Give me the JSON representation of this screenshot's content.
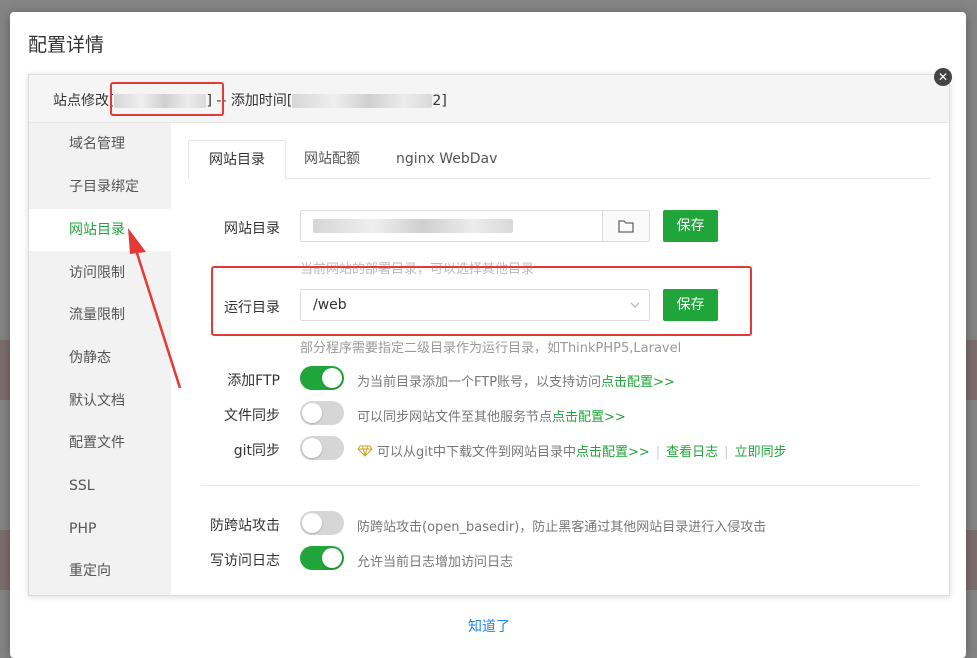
{
  "outer": {
    "title": "配置详情",
    "footer_link": "知道了"
  },
  "inner": {
    "title_prefix": "站点修改[",
    "title_mid": "] -- 添加时间[",
    "title_suffix": "2]"
  },
  "sidebar": {
    "items": [
      {
        "label": "域名管理"
      },
      {
        "label": "子目录绑定"
      },
      {
        "label": "网站目录"
      },
      {
        "label": "访问限制"
      },
      {
        "label": "流量限制"
      },
      {
        "label": "伪静态"
      },
      {
        "label": "默认文档"
      },
      {
        "label": "配置文件"
      },
      {
        "label": "SSL"
      },
      {
        "label": "PHP"
      },
      {
        "label": "重定向"
      }
    ],
    "active_index": 2
  },
  "tabs": [
    {
      "label": "网站目录"
    },
    {
      "label": "网站配额"
    },
    {
      "label": "nginx WebDav"
    }
  ],
  "form": {
    "site_dir": {
      "label": "网站目录",
      "save_label": "保存",
      "hint": "当前网站的部署目录，可以选择其他目录"
    },
    "run_dir": {
      "label": "运行目录",
      "value": "/web",
      "save_label": "保存",
      "hint": "部分程序需要指定二级目录作为运行目录，如ThinkPHP5,Laravel"
    },
    "ftp": {
      "label": "添加FTP",
      "on": true,
      "desc": "为当前目录添加一个FTP账号，以支持访问",
      "link": "点击配置>>"
    },
    "file_sync": {
      "label": "文件同步",
      "on": false,
      "desc": "可以同步网站文件至其他服务节点",
      "link": "点击配置>>"
    },
    "git_sync": {
      "label": "git同步",
      "on": false,
      "desc": "可以从git中下载文件到网站目录中",
      "link": "点击配置>>",
      "link_log": "查看日志",
      "link_sync": "立即同步"
    },
    "anti_cross": {
      "label": "防跨站攻击",
      "on": false,
      "desc": "防跨站攻击(open_basedir)，防止黑客通过其他网站目录进行入侵攻击"
    },
    "access_log": {
      "label": "写访问日志",
      "on": true,
      "desc": "允许当前日志增加访问日志"
    }
  },
  "colors": {
    "accent": "#20a53a",
    "annotation": "#e53935",
    "link_blue": "#1e88e5"
  }
}
